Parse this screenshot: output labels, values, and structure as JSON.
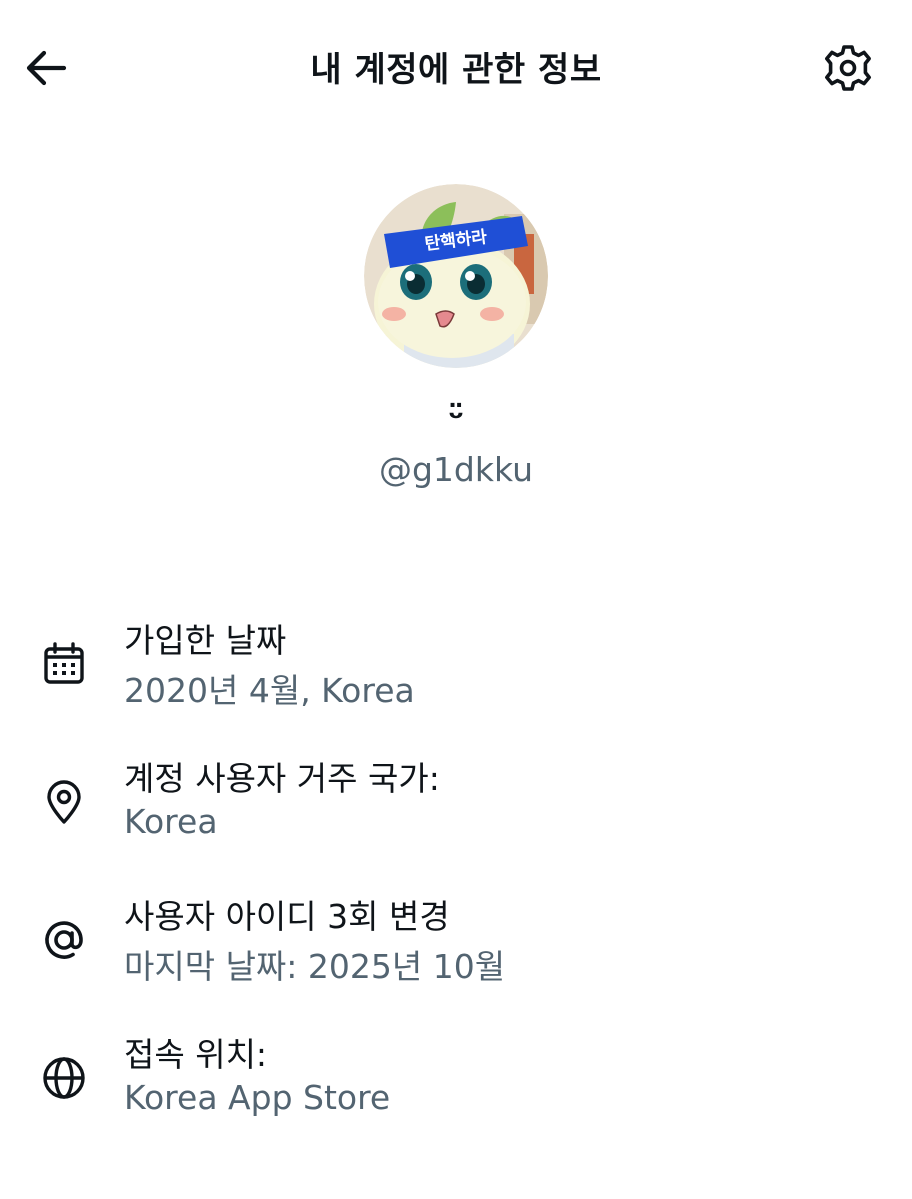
{
  "header": {
    "title": "내 계정에 관한 정보",
    "back_icon": "arrow-left-icon",
    "settings_icon": "gear-icon"
  },
  "profile": {
    "display_name": "ᵕ̈",
    "handle": "@g1dkku",
    "avatar_headband_text": "탄핵하라"
  },
  "info": {
    "items": [
      {
        "icon": "calendar-icon",
        "label": "가입한 날짜",
        "value": "2020년 4월, Korea"
      },
      {
        "icon": "location-pin-icon",
        "label": "계정 사용자 거주 국가:",
        "value": "Korea"
      },
      {
        "icon": "at-sign-icon",
        "label": "사용자 아이디 3회 변경",
        "value": "마지막 날짜: 2025년 10월"
      },
      {
        "icon": "globe-icon",
        "label": "접속 위치:",
        "value": "Korea App Store"
      }
    ]
  },
  "colors": {
    "text_primary": "#0f1419",
    "text_secondary": "#536471",
    "background": "#ffffff"
  }
}
